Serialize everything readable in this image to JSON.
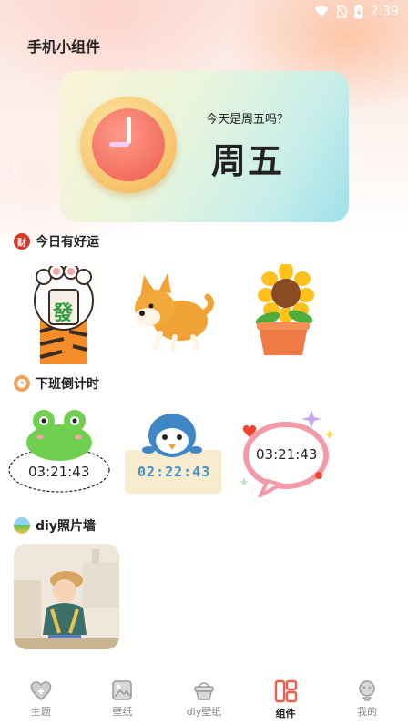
{
  "status_bar": {
    "time": "2:39"
  },
  "app": {
    "title": "手机小组件"
  },
  "date_widget": {
    "question": "今天是周五吗？",
    "day": "周五"
  },
  "sections": {
    "luck": {
      "badge": "财",
      "title": "今日有好运",
      "badge_color": "#d83a2a"
    },
    "countdown": {
      "title": "下班倒计时",
      "badge_color": "#f4a35a"
    },
    "photo_wall": {
      "title": "diy照片墙"
    }
  },
  "luck_items": [
    {
      "name": "lucky-cat-paw",
      "tile_text": "發"
    },
    {
      "name": "shiba-dog"
    },
    {
      "name": "sunflower-pot"
    }
  ],
  "countdown_items": [
    {
      "name": "frog-countdown",
      "time": "03:21:43"
    },
    {
      "name": "penguin-countdown",
      "time": "02:22:43"
    },
    {
      "name": "bubble-countdown",
      "time": "03:21:43"
    }
  ],
  "tabs": [
    {
      "label": "主题",
      "icon": "heart-icon",
      "active": false
    },
    {
      "label": "壁纸",
      "icon": "image-icon",
      "active": false
    },
    {
      "label": "diy壁纸",
      "icon": "basket-icon",
      "active": false
    },
    {
      "label": "组件",
      "icon": "widgets-icon",
      "active": true
    },
    {
      "label": "我的",
      "icon": "profile-icon",
      "active": false
    }
  ],
  "colors": {
    "accent": "#f25c4c",
    "text": "#222222",
    "muted": "#888888"
  }
}
